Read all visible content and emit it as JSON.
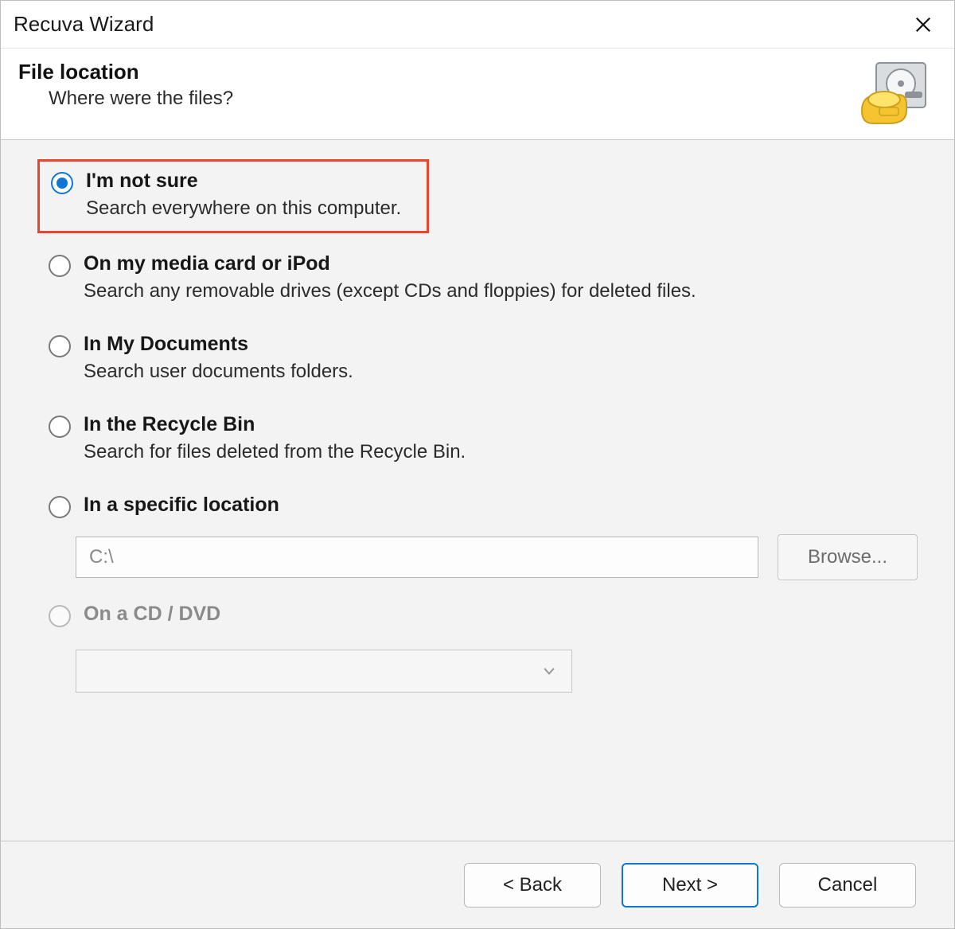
{
  "window": {
    "title": "Recuva Wizard"
  },
  "header": {
    "heading": "File location",
    "subheading": "Where were the files?"
  },
  "options": {
    "not_sure": {
      "label": "I'm not sure",
      "desc": "Search everywhere on this computer.",
      "selected": true,
      "highlighted": true
    },
    "media_card": {
      "label": "On my media card or iPod",
      "desc": "Search any removable drives (except CDs and floppies) for deleted files."
    },
    "documents": {
      "label": "In My Documents",
      "desc": "Search user documents folders."
    },
    "recycle": {
      "label": "In the Recycle Bin",
      "desc": "Search for files deleted from the Recycle Bin."
    },
    "specific": {
      "label": "In a specific location",
      "path_value": "C:\\",
      "browse_label": "Browse..."
    },
    "cd_dvd": {
      "label": "On a CD / DVD",
      "disabled": true
    }
  },
  "footer": {
    "back_label": "< Back",
    "next_label": "Next >",
    "cancel_label": "Cancel"
  },
  "colors": {
    "accent": "#1177d6",
    "highlight_border": "#e9452d"
  }
}
